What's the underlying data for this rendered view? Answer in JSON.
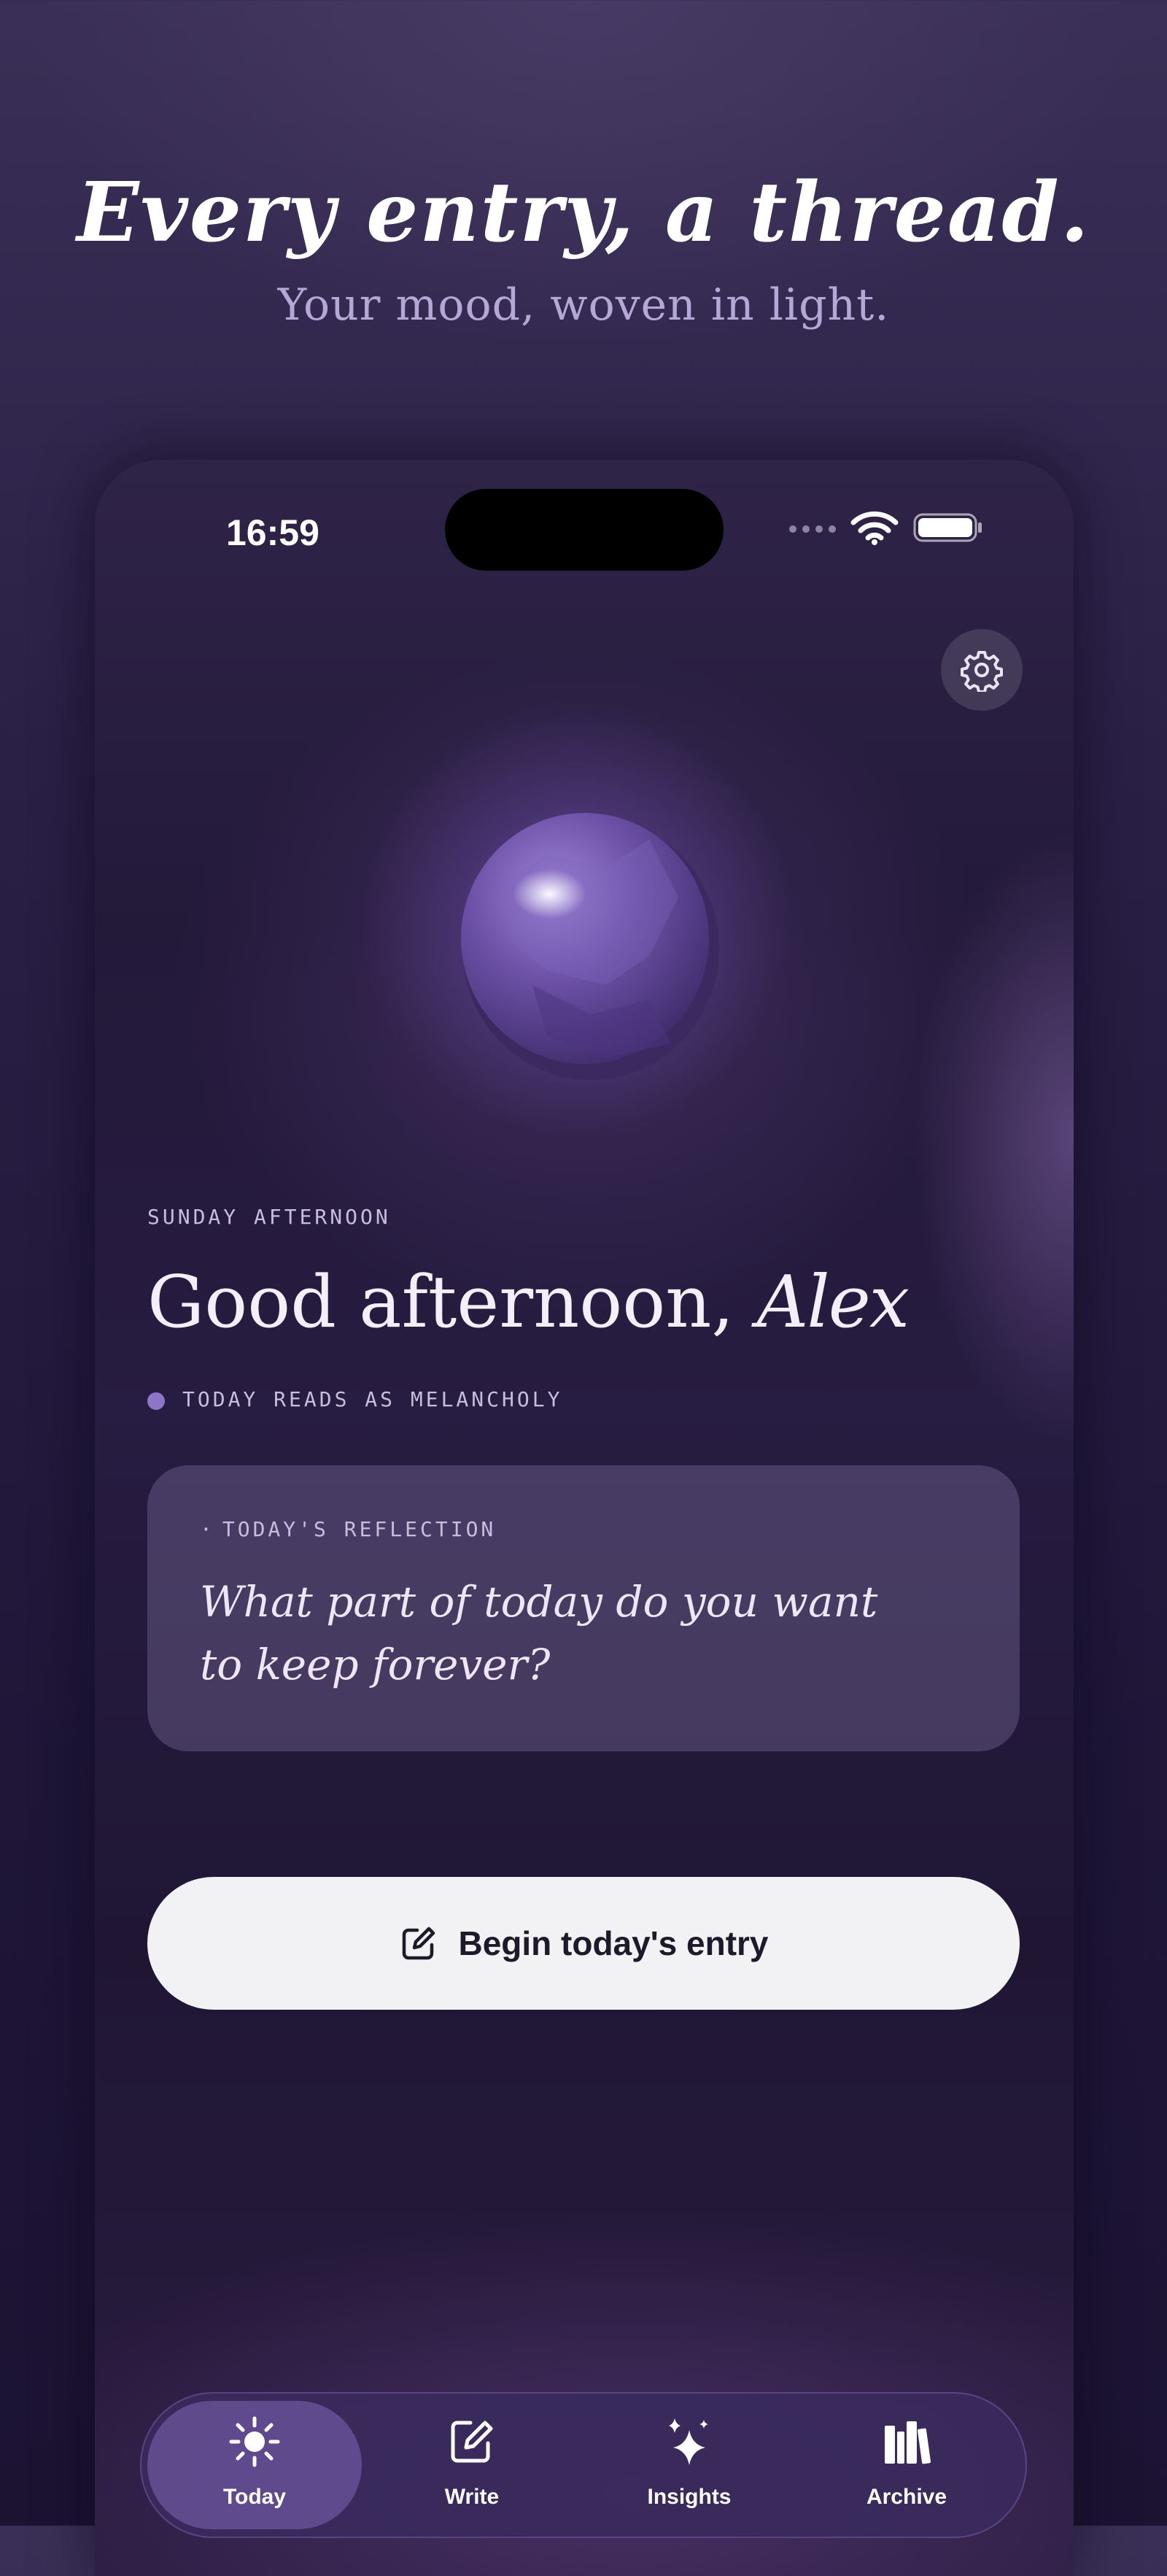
{
  "hero": {
    "title": "Every entry, a thread.",
    "subtitle": "Your mood, woven in light."
  },
  "status_bar": {
    "time": "16:59"
  },
  "greeting": {
    "day_label": "SUNDAY AFTERNOON",
    "text": "Good afternoon, ",
    "name": "Alex",
    "mood_text": "TODAY READS AS MELANCHOLY"
  },
  "reflection": {
    "bullet": "·",
    "label": "TODAY'S REFLECTION",
    "prompt": "What part of today do you want to keep forever?"
  },
  "begin_button": {
    "label": "Begin today's entry",
    "icon": "compose-icon"
  },
  "tabs": [
    {
      "label": "Today",
      "icon": "sun-icon",
      "active": true
    },
    {
      "label": "Write",
      "icon": "compose-icon",
      "active": false
    },
    {
      "label": "Insights",
      "icon": "sparkles-icon",
      "active": false
    },
    {
      "label": "Archive",
      "icon": "books-icon",
      "active": false
    }
  ],
  "colors": {
    "background": "#2a1f45",
    "accent": "#8e76c6",
    "mood_dot": "#8e76c6",
    "button_bg": "#f2f2f4",
    "subtitle": "#b6a8d6"
  }
}
